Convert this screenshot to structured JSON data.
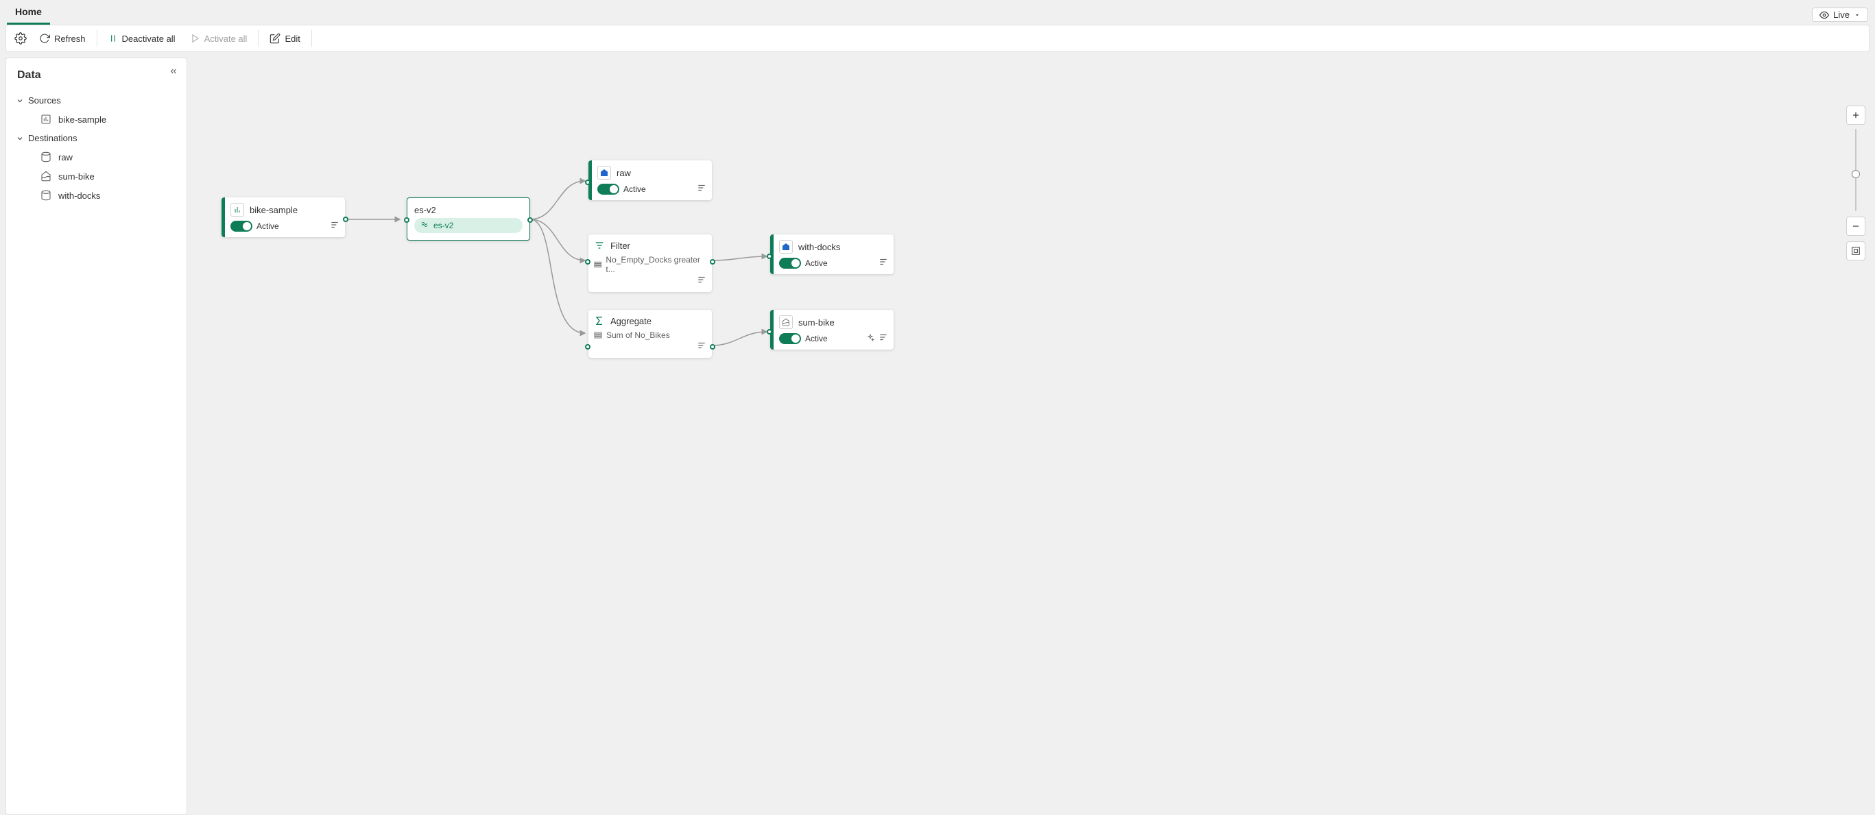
{
  "tabs": {
    "home": "Home"
  },
  "topRight": {
    "live": "Live"
  },
  "toolbar": {
    "refresh": "Refresh",
    "deactivate_all": "Deactivate all",
    "activate_all": "Activate all",
    "edit": "Edit"
  },
  "sidebar": {
    "title": "Data",
    "groups": {
      "sources": {
        "label": "Sources",
        "items": [
          "bike-sample"
        ]
      },
      "destinations": {
        "label": "Destinations",
        "items": [
          "raw",
          "sum-bike",
          "with-docks"
        ]
      }
    }
  },
  "nodes": {
    "bike_sample": {
      "title": "bike-sample",
      "status": "Active"
    },
    "es_v2": {
      "title": "es-v2",
      "chip": "es-v2"
    },
    "raw": {
      "title": "raw",
      "status": "Active"
    },
    "filter": {
      "title": "Filter",
      "detail": "No_Empty_Docks greater t..."
    },
    "aggregate": {
      "title": "Aggregate",
      "detail": "Sum of No_Bikes"
    },
    "with_docks": {
      "title": "with-docks",
      "status": "Active"
    },
    "sum_bike": {
      "title": "sum-bike",
      "status": "Active"
    }
  }
}
